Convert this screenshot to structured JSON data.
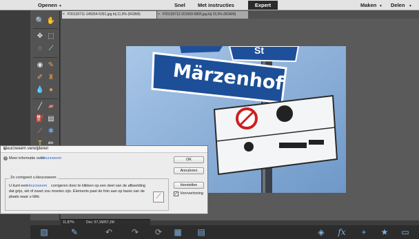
{
  "topbar": {
    "open": "Openen",
    "quick": "Snel",
    "guided": "Met instructies",
    "expert": "Expert",
    "create": "Maken",
    "share": "Delen"
  },
  "file_tabs": [
    {
      "label": "P20130711-145654-5391.jpg bij 11,9% (RGB/8)",
      "close": "×"
    },
    {
      "label": "P20130712-201659-5805.jpg bij 15,5% (RGB/8)",
      "close": "×"
    }
  ],
  "photo": {
    "street_sign": "Märzenhof",
    "top_sign_fragment": "St"
  },
  "status": {
    "zoom": "11,87%",
    "doc": "Doc: 57,1M/57,1M"
  },
  "dialog": {
    "title": "Kleurzweem verwijderen",
    "close": "×",
    "info_prefix": "Meer informatie over:",
    "info_link": "Kleurzweem",
    "ok": "OK",
    "cancel": "Annuleren",
    "reset": "Herstellen",
    "group_title": "Zo corrigeert u kleurzweem",
    "instr_1a": "U kunt een",
    "instr_1link": "kleurzweem",
    "instr_1b": "corrigeren door te klikken op een deel van de afbeelding",
    "instr_2": "dat grijs, wit of zwart zou moeten zijn. Elements past de foto aan op basis van de",
    "instr_3": "plaats waar u klikt.",
    "preview": "Voorvertoning",
    "preview_checked": true
  },
  "colors": {
    "accent": "#2b2b2b",
    "toolbar_bg": "#535353",
    "bottom_icon": "#7fb2e6",
    "link": "#2a66c9"
  }
}
